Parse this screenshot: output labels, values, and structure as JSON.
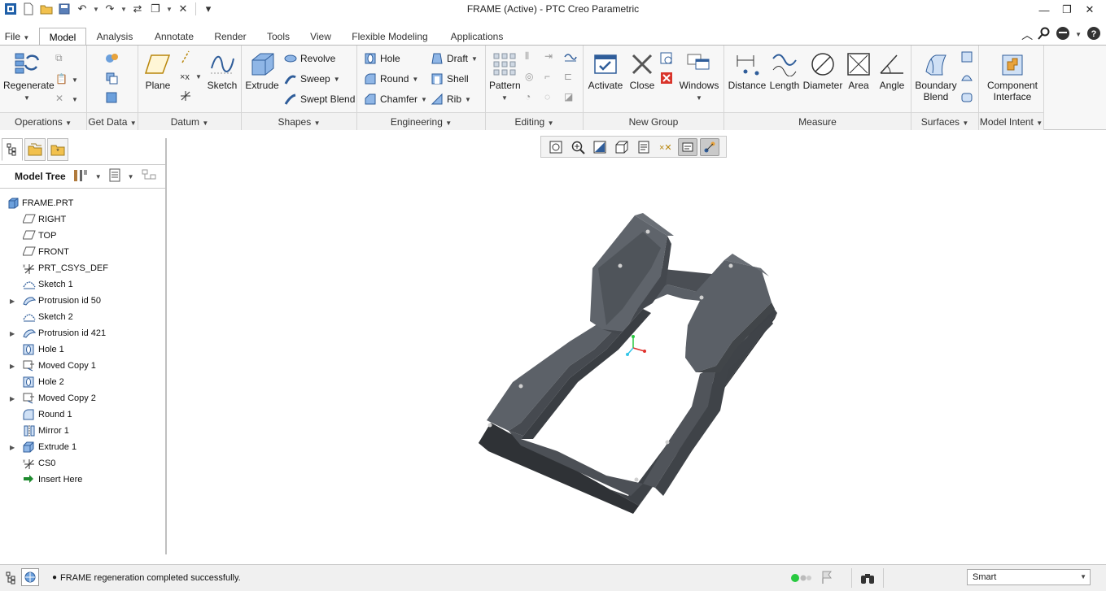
{
  "window": {
    "title": "FRAME (Active) - PTC Creo Parametric"
  },
  "tabs": [
    "File",
    "Model",
    "Analysis",
    "Annotate",
    "Render",
    "Tools",
    "View",
    "Flexible Modeling",
    "Applications"
  ],
  "active_tab": "Model",
  "ribbon": {
    "operations": {
      "regenerate": "Regenerate",
      "footer": "Operations"
    },
    "get_data": {
      "footer": "Get Data"
    },
    "datum": {
      "plane": "Plane",
      "sketch": "Sketch",
      "footer": "Datum"
    },
    "shapes": {
      "extrude": "Extrude",
      "revolve": "Revolve",
      "sweep": "Sweep",
      "swept_blend": "Swept Blend",
      "footer": "Shapes"
    },
    "engineering": {
      "hole": "Hole",
      "round": "Round",
      "chamfer": "Chamfer",
      "draft": "Draft",
      "shell": "Shell",
      "rib": "Rib",
      "footer": "Engineering"
    },
    "editing": {
      "pattern": "Pattern",
      "footer": "Editing"
    },
    "new_group": {
      "activate": "Activate",
      "close": "Close",
      "windows": "Windows",
      "footer": "New Group"
    },
    "measure": {
      "distance": "Distance",
      "length": "Length",
      "diameter": "Diameter",
      "area": "Area",
      "angle": "Angle",
      "footer": "Measure"
    },
    "surfaces": {
      "boundary_blend_1": "Boundary",
      "boundary_blend_2": "Blend",
      "footer": "Surfaces"
    },
    "model_intent": {
      "component_1": "Component",
      "component_2": "Interface",
      "footer": "Model Intent"
    }
  },
  "model_tree": {
    "header": "Model Tree",
    "items": [
      {
        "label": "FRAME.PRT",
        "icon": "part-icon",
        "expandable": false,
        "root": true
      },
      {
        "label": "RIGHT",
        "icon": "datum-plane-icon",
        "expandable": false
      },
      {
        "label": "TOP",
        "icon": "datum-plane-icon",
        "expandable": false
      },
      {
        "label": "FRONT",
        "icon": "datum-plane-icon",
        "expandable": false
      },
      {
        "label": "PRT_CSYS_DEF",
        "icon": "csys-icon",
        "expandable": false
      },
      {
        "label": "Sketch 1",
        "icon": "sketch-icon",
        "expandable": false
      },
      {
        "label": "Protrusion id 50",
        "icon": "protrusion-icon",
        "expandable": true
      },
      {
        "label": "Sketch 2",
        "icon": "sketch-icon",
        "expandable": false
      },
      {
        "label": "Protrusion id 421",
        "icon": "protrusion-icon",
        "expandable": true
      },
      {
        "label": "Hole 1",
        "icon": "hole-icon",
        "expandable": false
      },
      {
        "label": "Moved Copy 1",
        "icon": "moved-copy-icon",
        "expandable": true
      },
      {
        "label": "Hole 2",
        "icon": "hole-icon",
        "expandable": false
      },
      {
        "label": "Moved Copy 2",
        "icon": "moved-copy-icon",
        "expandable": true
      },
      {
        "label": "Round 1",
        "icon": "round-icon",
        "expandable": false
      },
      {
        "label": "Mirror 1",
        "icon": "mirror-icon",
        "expandable": false
      },
      {
        "label": "Extrude 1",
        "icon": "extrude-icon",
        "expandable": true
      },
      {
        "label": "CS0",
        "icon": "csys-icon",
        "expandable": false
      },
      {
        "label": "Insert Here",
        "icon": "insert-arrow-icon",
        "expandable": false
      }
    ]
  },
  "status": {
    "message": "FRAME regeneration completed successfully.",
    "filter": "Smart"
  },
  "colors": {
    "model": "#4a4e53",
    "accent": "#1f5fa8"
  }
}
